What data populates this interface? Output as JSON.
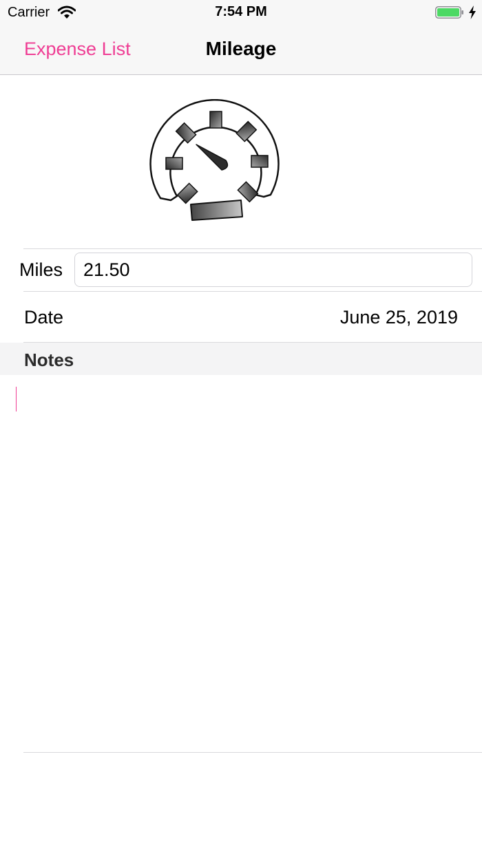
{
  "status_bar": {
    "carrier": "Carrier",
    "time": "7:54 PM",
    "battery_color": "#4cd964"
  },
  "nav": {
    "back_label": "Expense List",
    "title": "Mileage",
    "accent_color": "#ef3d94"
  },
  "hero": {
    "icon": "speedometer-icon"
  },
  "form": {
    "miles_label": "Miles",
    "miles_value": "21.50",
    "date_label": "Date",
    "date_value": "June 25, 2019"
  },
  "notes": {
    "header": "Notes",
    "text": ""
  }
}
